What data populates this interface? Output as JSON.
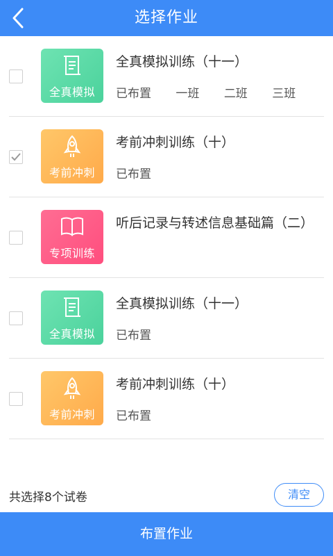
{
  "header": {
    "title": "选择作业",
    "back_icon": "chevron-left-icon"
  },
  "items": [
    {
      "tile_label": "全真模拟",
      "tile_color": "#4bd29c",
      "tile_icon": "document-scroll-icon",
      "title": "全真模拟训练（十一）",
      "checked": false,
      "meta": [
        "已布置",
        "一班",
        "二班",
        "三班"
      ]
    },
    {
      "tile_label": "考前冲刺",
      "tile_color": "#ffaa4a",
      "tile_icon": "rocket-icon",
      "title": "考前冲刺训练（十）",
      "checked": true,
      "meta": [
        "已布置"
      ]
    },
    {
      "tile_label": "专项训练",
      "tile_color": "#ff4e7e",
      "tile_icon": "open-book-icon",
      "title": "听后记录与转述信息基础篇（二）",
      "checked": false,
      "meta": []
    },
    {
      "tile_label": "全真模拟",
      "tile_color": "#4bd29c",
      "tile_icon": "document-scroll-icon",
      "title": "全真模拟训练（十一）",
      "checked": false,
      "meta": [
        "已布置"
      ]
    },
    {
      "tile_label": "考前冲刺",
      "tile_color": "#ffaa4a",
      "tile_icon": "rocket-icon",
      "title": "考前冲刺训练（十）",
      "checked": false,
      "meta": [
        "已布置"
      ]
    }
  ],
  "summary": {
    "text": "共选择8个试卷",
    "clear_label": "清空"
  },
  "footer": {
    "assign_label": "布置作业"
  },
  "colors": {
    "primary": "#3d8bf7"
  }
}
